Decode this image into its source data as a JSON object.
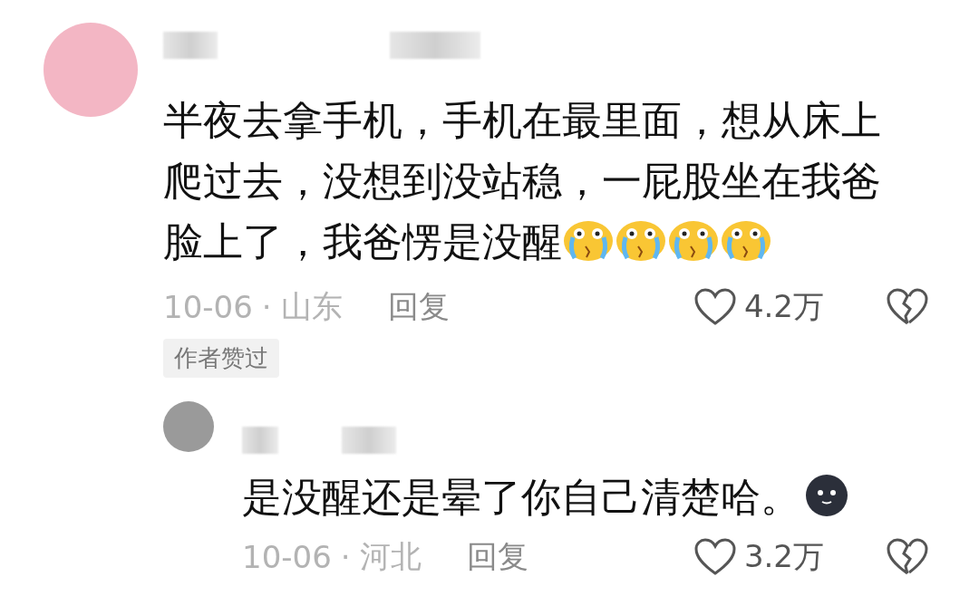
{
  "comment": {
    "lines": [
      "半夜去拿手机，手机在最里面，想从床上",
      "爬过去，没想到没站稳，一屁股坐在我爸",
      "脸上了，我爸愣是没醒"
    ],
    "emojis": [
      {
        "kind": "crying"
      },
      {
        "kind": "crying"
      },
      {
        "kind": "crying"
      },
      {
        "kind": "crying"
      }
    ],
    "date": "10-06",
    "separator": "·",
    "region": "山东",
    "reply_label": "回复",
    "likes": "4.2万",
    "badge": "作者赞过",
    "replies": [
      {
        "lines": [
          "是没醒还是晕了你自己清楚哈。"
        ],
        "emojis": [
          {
            "kind": "dark-face"
          }
        ],
        "date": "10-06",
        "separator": "·",
        "region": "河北",
        "reply_label": "回复",
        "likes": "3.2万"
      }
    ]
  }
}
